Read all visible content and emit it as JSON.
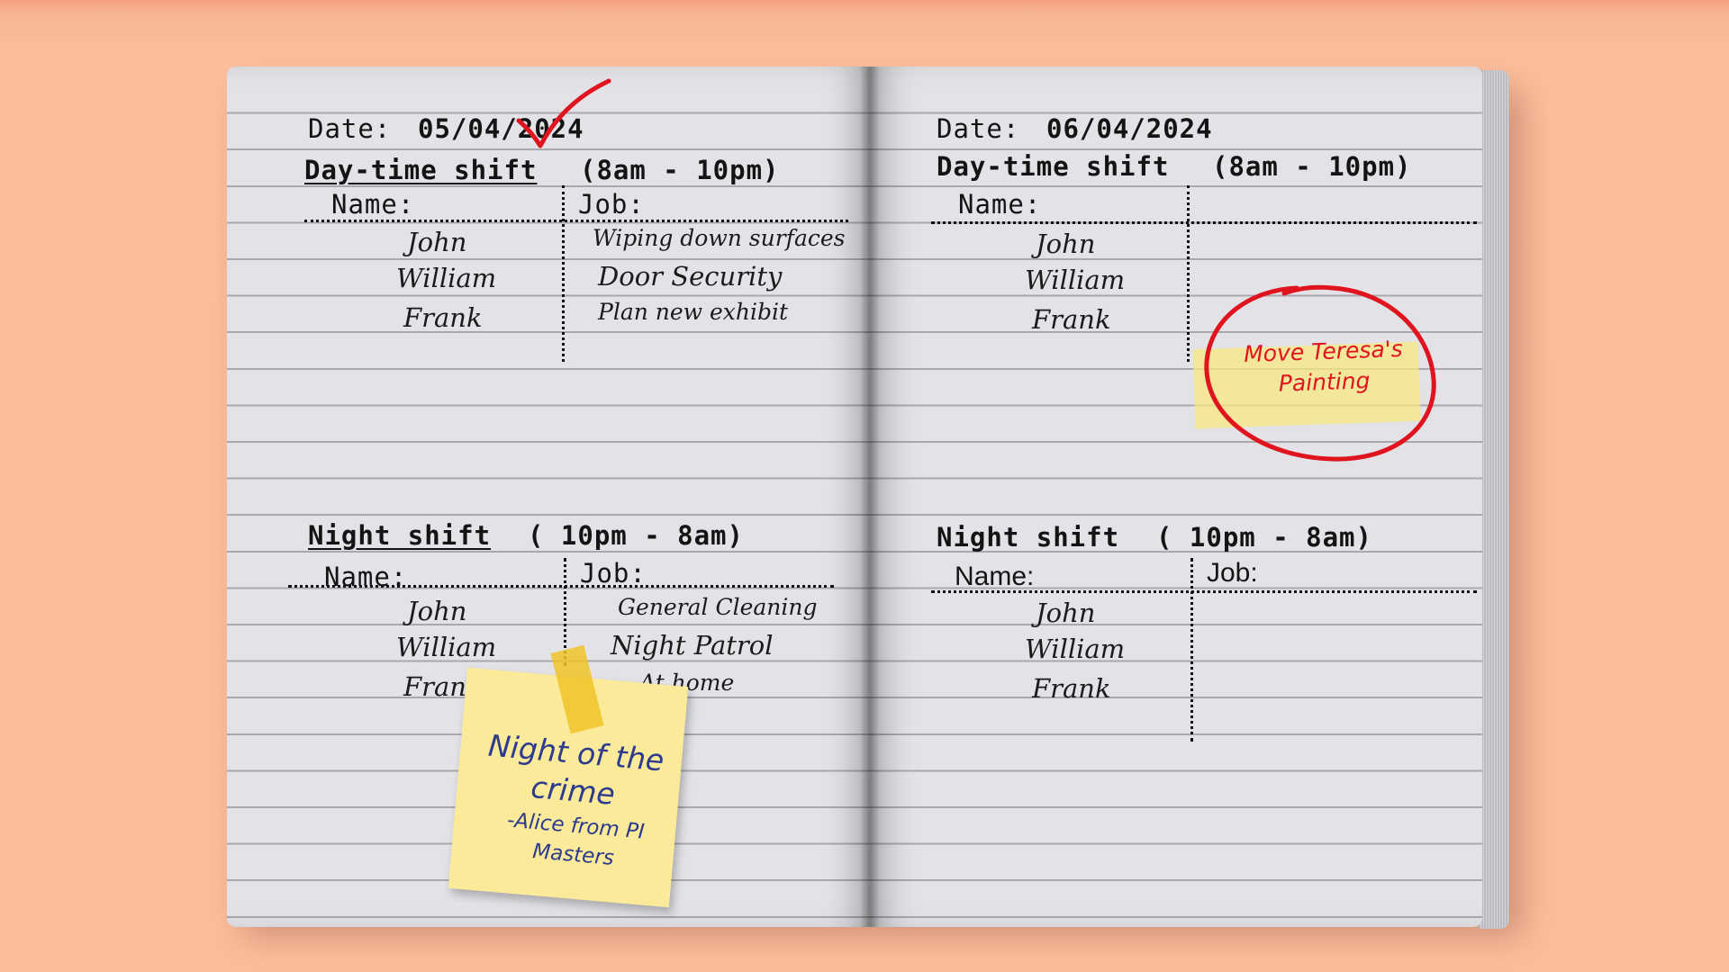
{
  "left_page": {
    "date_label": "Date:",
    "date_value": "05/04/2024",
    "day_shift": {
      "title": "Day-time shift",
      "hours": "(8am - 10pm)",
      "name_header": "Name:",
      "job_header": "Job:",
      "names": [
        "John",
        "William",
        "Frank"
      ],
      "jobs": [
        "Wiping down surfaces",
        "Door Security",
        "Plan new exhibit"
      ]
    },
    "night_shift": {
      "title": "Night shift",
      "hours": "( 10pm - 8am)",
      "name_header": "Name:",
      "job_header": "Job:",
      "names": [
        "John",
        "William",
        "Frank"
      ],
      "jobs": [
        "General Cleaning",
        "Night Patrol",
        "At home"
      ]
    }
  },
  "right_page": {
    "date_label": "Date:",
    "date_value": "06/04/2024",
    "day_shift": {
      "title": "Day-time shift",
      "hours": "(8am - 10pm)",
      "name_header": "Name:",
      "names": [
        "John",
        "William",
        "Frank"
      ]
    },
    "night_shift": {
      "title": "Night shift",
      "hours": "( 10pm - 8am)",
      "name_header": "Name:",
      "job_header": "Job:",
      "names": [
        "John",
        "William",
        "Frank"
      ]
    }
  },
  "sticky_note": {
    "title": "Night of the crime",
    "signature": "-Alice from PI Masters",
    "text_color": "#2d3b8e",
    "paper_color": "#fbea99"
  },
  "red_note": {
    "text": "Move Teresa's Painting",
    "color": "#e0141e"
  },
  "colors": {
    "background": "#fbbd9b",
    "page": "#e3e2e6",
    "checkmark": "#e0141e"
  }
}
